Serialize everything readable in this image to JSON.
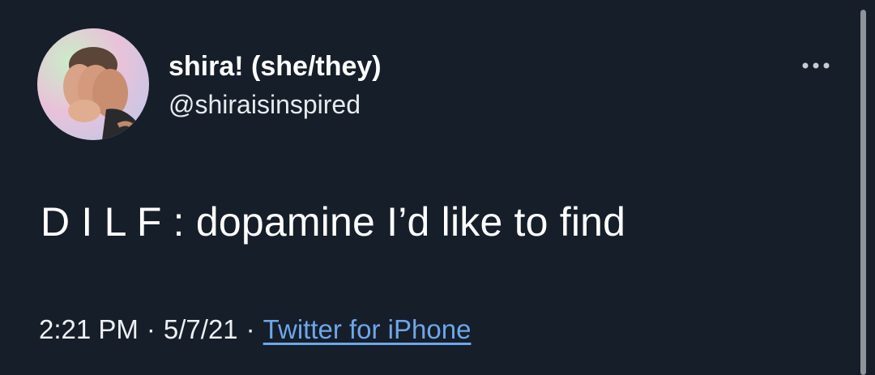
{
  "tweet": {
    "author": {
      "display_name": "shira! (she/they)",
      "handle": "@shiraisinspired",
      "avatar_icon": "user-avatar"
    },
    "text": "D I L F : dopamine I’d like to find",
    "meta": {
      "time": "2:21 PM",
      "separator": "·",
      "date": "5/7/21",
      "source": "Twitter for iPhone"
    },
    "more_icon": "more-horizontal-icon"
  },
  "colors": {
    "background": "#161e29",
    "text": "#ffffff",
    "link": "#6ea6ea"
  }
}
